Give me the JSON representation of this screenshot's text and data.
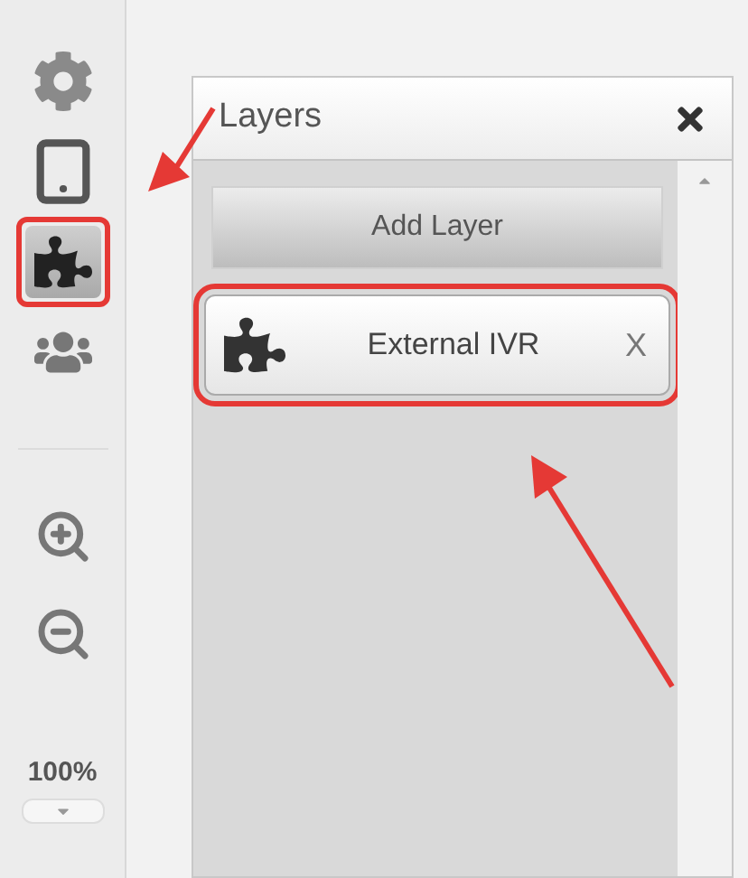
{
  "sidebar": {
    "tools": [
      {
        "kind": "gear",
        "selected": false,
        "highlighted": false
      },
      {
        "kind": "tablet",
        "selected": false,
        "highlighted": false
      },
      {
        "kind": "puzzle",
        "selected": true,
        "highlighted": true
      },
      {
        "kind": "people",
        "selected": false,
        "highlighted": false
      }
    ],
    "zoom_tools": [
      {
        "kind": "zoom-in"
      },
      {
        "kind": "zoom-out"
      }
    ],
    "zoom_level": "100%"
  },
  "panel": {
    "title": "Layers",
    "add_button": "Add Layer",
    "layers": [
      {
        "name": "External IVR",
        "remove": "X",
        "highlighted": true
      }
    ]
  }
}
